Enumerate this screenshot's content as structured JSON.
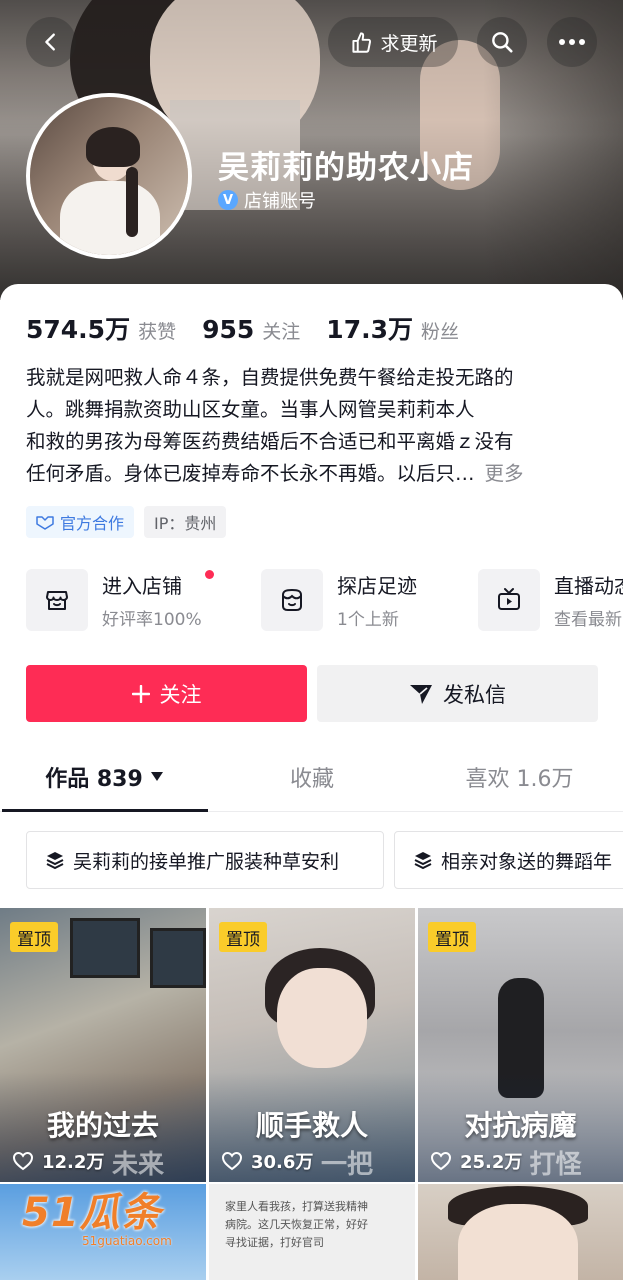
{
  "header": {
    "update_label": "求更新",
    "icons": {
      "back": "chevron-left-icon",
      "update": "hand-point-icon",
      "search": "search-icon",
      "more": "more-dots-icon"
    }
  },
  "profile": {
    "name": "吴莉莉的助农小店",
    "account_type": "店铺账号",
    "verify_badge": "V"
  },
  "stats": [
    {
      "value": "574.5万",
      "label": "获赞"
    },
    {
      "value": "955",
      "label": "关注"
    },
    {
      "value": "17.3万",
      "label": "粉丝"
    }
  ],
  "bio": {
    "lines": [
      "我就是网吧救人命４条，自费提供免费午餐给走投无路的",
      "人。跳舞捐款资助山区女童。当事人网管吴莉莉本人",
      "和救的男孩为母筹医药费结婚后不合适已和平离婚ｚ没有",
      "任何矛盾。身体已废掉寿命不长永不再婚。以后只…"
    ],
    "more_label": "更多"
  },
  "tags": {
    "official": "官方合作",
    "ip": "IP：贵州"
  },
  "shortcuts": [
    {
      "title": "进入店铺",
      "subtitle": "好评率100%",
      "icon": "store-icon",
      "dot": true
    },
    {
      "title": "探店足迹",
      "subtitle": "1个上新",
      "icon": "shop-visit-icon",
      "dot": false
    },
    {
      "title": "直播动态",
      "subtitle": "查看最新",
      "icon": "tv-icon",
      "dot": false
    }
  ],
  "actions": {
    "follow": "关注",
    "message": "发私信"
  },
  "tabs": [
    {
      "label": "作品 839",
      "active": true
    },
    {
      "label": "收藏",
      "active": false
    },
    {
      "label": "喜欢 1.6万",
      "active": false
    }
  ],
  "collections": [
    "吴莉莉的接单推广服装种草安利",
    "相亲对象送的舞蹈年"
  ],
  "videos": [
    {
      "pinned": "置顶",
      "caption": "我的过去",
      "caption2": "未来",
      "likes": "12.2万"
    },
    {
      "pinned": "置顶",
      "caption": "顺手救人",
      "caption2": "一把",
      "likes": "30.6万"
    },
    {
      "pinned": "置顶",
      "caption": "对抗病魔",
      "caption2": "打怪",
      "likes": "25.2万"
    }
  ],
  "video_e_text": "家里人看我孩，打算送我精神病院。这几天恢复正常，好好寻找证据，打好官司",
  "watermark": {
    "brand": "51瓜条",
    "url": "51guatiao.com"
  }
}
